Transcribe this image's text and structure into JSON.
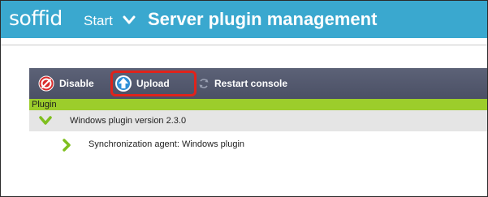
{
  "header": {
    "logo_text": "soffid",
    "start_label": "Start",
    "title": "Server plugin management",
    "bar_color": "#3aa8cf"
  },
  "toolbar": {
    "disable_label": "Disable",
    "disable_icon": "disable-icon",
    "upload_label": "Upload",
    "upload_icon": "upload-icon",
    "upload_highlighted": true,
    "restart_label": "Restart console",
    "restart_icon": "restart-icon"
  },
  "table": {
    "column_header": "Plugin",
    "header_color": "#9ccd2b",
    "rows": [
      {
        "label": "Windows plugin version 2.3.0",
        "expanded": true,
        "icon": "chevron-down-icon"
      },
      {
        "label": "Synchronization agent: Windows plugin",
        "expanded": false,
        "icon": "chevron-right-icon"
      }
    ]
  }
}
